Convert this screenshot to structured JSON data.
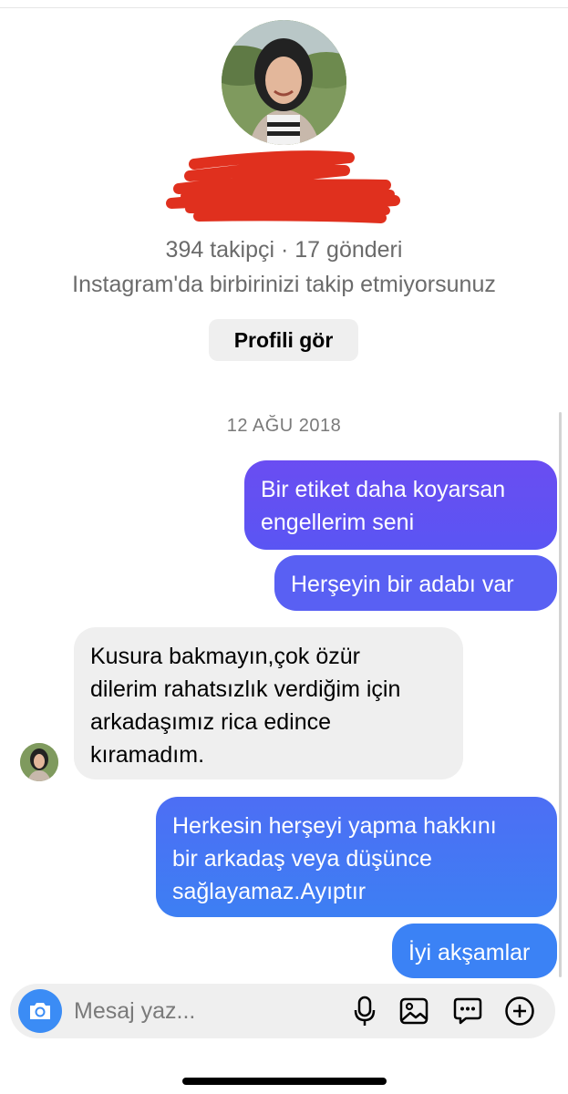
{
  "profile": {
    "stats": "394 takipçi · 17 gönderi",
    "mutual_text": "Instagram'da birbirinizi takip etmiyorsunuz",
    "view_profile_label": "Profili gör"
  },
  "thread": {
    "date": "12 AĞU 2018",
    "messages": [
      {
        "from": "me",
        "lines": [
          "Bir etiket daha koyarsan",
          "engellerim seni"
        ]
      },
      {
        "from": "me",
        "lines": [
          "Herşeyin bir adabı var"
        ]
      },
      {
        "from": "them",
        "lines": [
          "Kusura bakmayın,çok özür",
          "dilerim rahatsızlık verdiğim için",
          "arkadaşımız rica edince",
          "kıramadım."
        ]
      },
      {
        "from": "me",
        "lines": [
          "Herkesin herşeyi yapma hakkını",
          "bir arkadaş veya düşünce",
          "sağlayamaz.Ayıptır"
        ]
      },
      {
        "from": "me",
        "lines": [
          "İyi akşamlar"
        ]
      }
    ]
  },
  "composer": {
    "placeholder": "Mesaj yaz...",
    "icons": [
      "camera-icon",
      "microphone-icon",
      "gallery-icon",
      "sticker-icon",
      "plus-icon"
    ]
  },
  "colors": {
    "outgoing_top": "#6a4df2",
    "outgoing_bottom": "#3b82f5",
    "incoming": "#efefef",
    "camera": "#3b8cf5",
    "redaction": "#e0301e"
  }
}
